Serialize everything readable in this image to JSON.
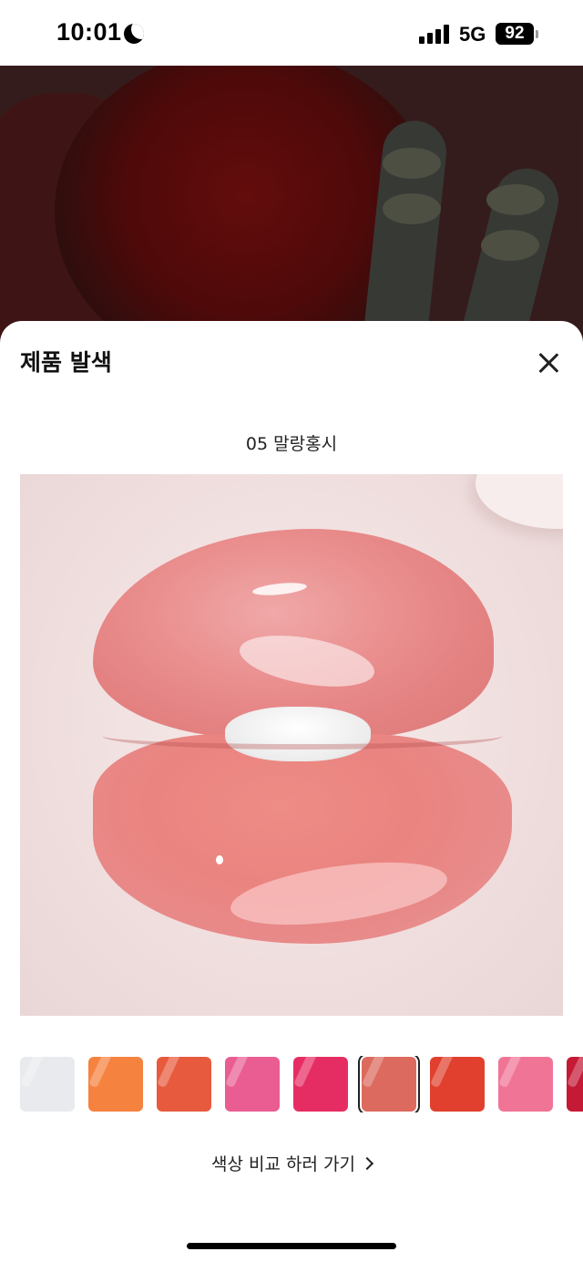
{
  "status_bar": {
    "time": "10:01",
    "network": "5G",
    "battery": "92"
  },
  "sheet": {
    "title": "제품 발색",
    "close_label": "close",
    "shade_name": "05 말랑홍시",
    "compare_link": "색상 비교 하러 가기"
  },
  "swatches": [
    {
      "color": "#e9eaee",
      "selected": false
    },
    {
      "color": "#f6823f",
      "selected": false
    },
    {
      "color": "#e85a3e",
      "selected": false
    },
    {
      "color": "#e95d92",
      "selected": false
    },
    {
      "color": "#e62d63",
      "selected": false
    },
    {
      "color": "#dc6a5e",
      "selected": true
    },
    {
      "color": "#e0402d",
      "selected": false
    },
    {
      "color": "#f07496",
      "selected": false
    },
    {
      "color": "#c51a36",
      "selected": false
    }
  ],
  "colors": {
    "accent": "#222222",
    "sheet_background": "#ffffff"
  }
}
